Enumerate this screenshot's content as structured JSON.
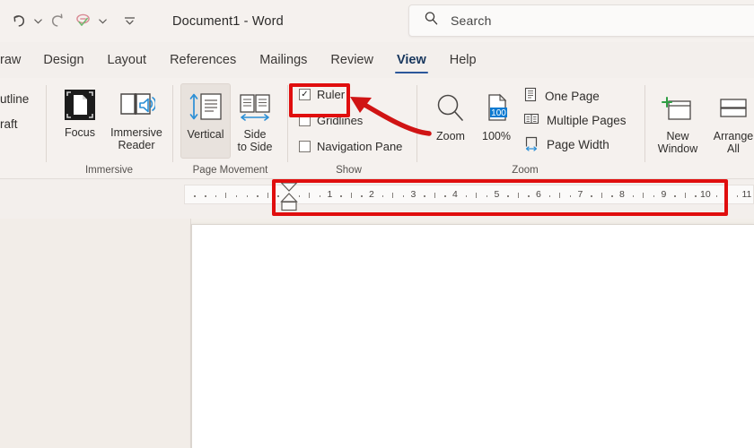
{
  "titlebar": {
    "document_title": "Document1  -  Word",
    "quick_access": [
      {
        "name": "undo-icon",
        "label": "Undo"
      },
      {
        "name": "undo-dropdown-caret-icon",
        "label": "Undo options"
      },
      {
        "name": "redo-icon",
        "label": "Redo"
      },
      {
        "name": "spelling-check-icon",
        "label": "Editor / Spelling & Grammar Check"
      },
      {
        "name": "spelling-dropdown-caret-icon",
        "label": "Editor options"
      },
      {
        "name": "customize-quick-access-toolbar-icon",
        "label": "Customize Quick Access Toolbar"
      }
    ]
  },
  "search": {
    "placeholder": "Search",
    "icon": "search-icon"
  },
  "tabs": [
    {
      "label": "raw",
      "active": false
    },
    {
      "label": "Design",
      "active": false
    },
    {
      "label": "Layout",
      "active": false
    },
    {
      "label": "References",
      "active": false
    },
    {
      "label": "Mailings",
      "active": false
    },
    {
      "label": "Review",
      "active": false
    },
    {
      "label": "View",
      "active": true
    },
    {
      "label": "Help",
      "active": false
    }
  ],
  "views_group_cut": {
    "item1": "utline",
    "item2": "raft"
  },
  "ribbon": {
    "groups": [
      {
        "label": "Immersive",
        "buttons": [
          {
            "label": "Focus",
            "icon": "focus-mode-icon"
          },
          {
            "label": "Immersive\nReader",
            "line1": "Immersive",
            "line2": "Reader",
            "icon": "immersive-reader-icon"
          }
        ]
      },
      {
        "label": "Page Movement",
        "buttons": [
          {
            "label": "Vertical",
            "icon": "vertical-page-movement-icon",
            "selected": true
          },
          {
            "line1": "Side",
            "line2": "to Side",
            "icon": "side-to-side-icon",
            "selected": false
          }
        ]
      },
      {
        "label": "Show",
        "checkboxes": [
          {
            "label": "Ruler",
            "checked": true,
            "highlighted": true
          },
          {
            "label": "Gridlines",
            "checked": false,
            "highlighted": false
          },
          {
            "label": "Navigation Pane",
            "checked": false,
            "highlighted": false
          }
        ]
      },
      {
        "label": "Zoom",
        "buttons": [
          {
            "label": "Zoom",
            "icon": "zoom-magnifier-icon"
          },
          {
            "label": "100%",
            "icon": "zoom-100-percent-icon",
            "badge": "100"
          }
        ],
        "list_items": [
          {
            "label": "One Page",
            "icon": "one-page-icon"
          },
          {
            "label": "Multiple Pages",
            "icon": "multiple-pages-icon"
          },
          {
            "label": "Page Width",
            "icon": "page-width-icon"
          }
        ]
      },
      {
        "label": "",
        "buttons": [
          {
            "line1": "New",
            "line2": "Window",
            "icon": "new-window-icon"
          },
          {
            "line1": "Arrange",
            "line2": "All",
            "icon": "arrange-all-icon"
          }
        ]
      }
    ]
  },
  "ruler": {
    "numbers": [
      "1",
      "2",
      "3",
      "4",
      "5",
      "6",
      "7",
      "8",
      "9",
      "10",
      "11"
    ],
    "indent_markers": [
      "first-line-indent-marker",
      "hanging-indent-marker",
      "left-indent-marker"
    ]
  },
  "annotations": {
    "ruler_checkbox_box_color": "#e00e0e",
    "ruler_strip_box_color": "#e00e0e",
    "arrow_color": "#d01414"
  },
  "colors": {
    "accent": "#2b579a",
    "app_background": "#f5f1ee",
    "page_background": "#ffffff",
    "annotation_red": "#e00e0e",
    "badge_blue": "#0b7ad1"
  }
}
